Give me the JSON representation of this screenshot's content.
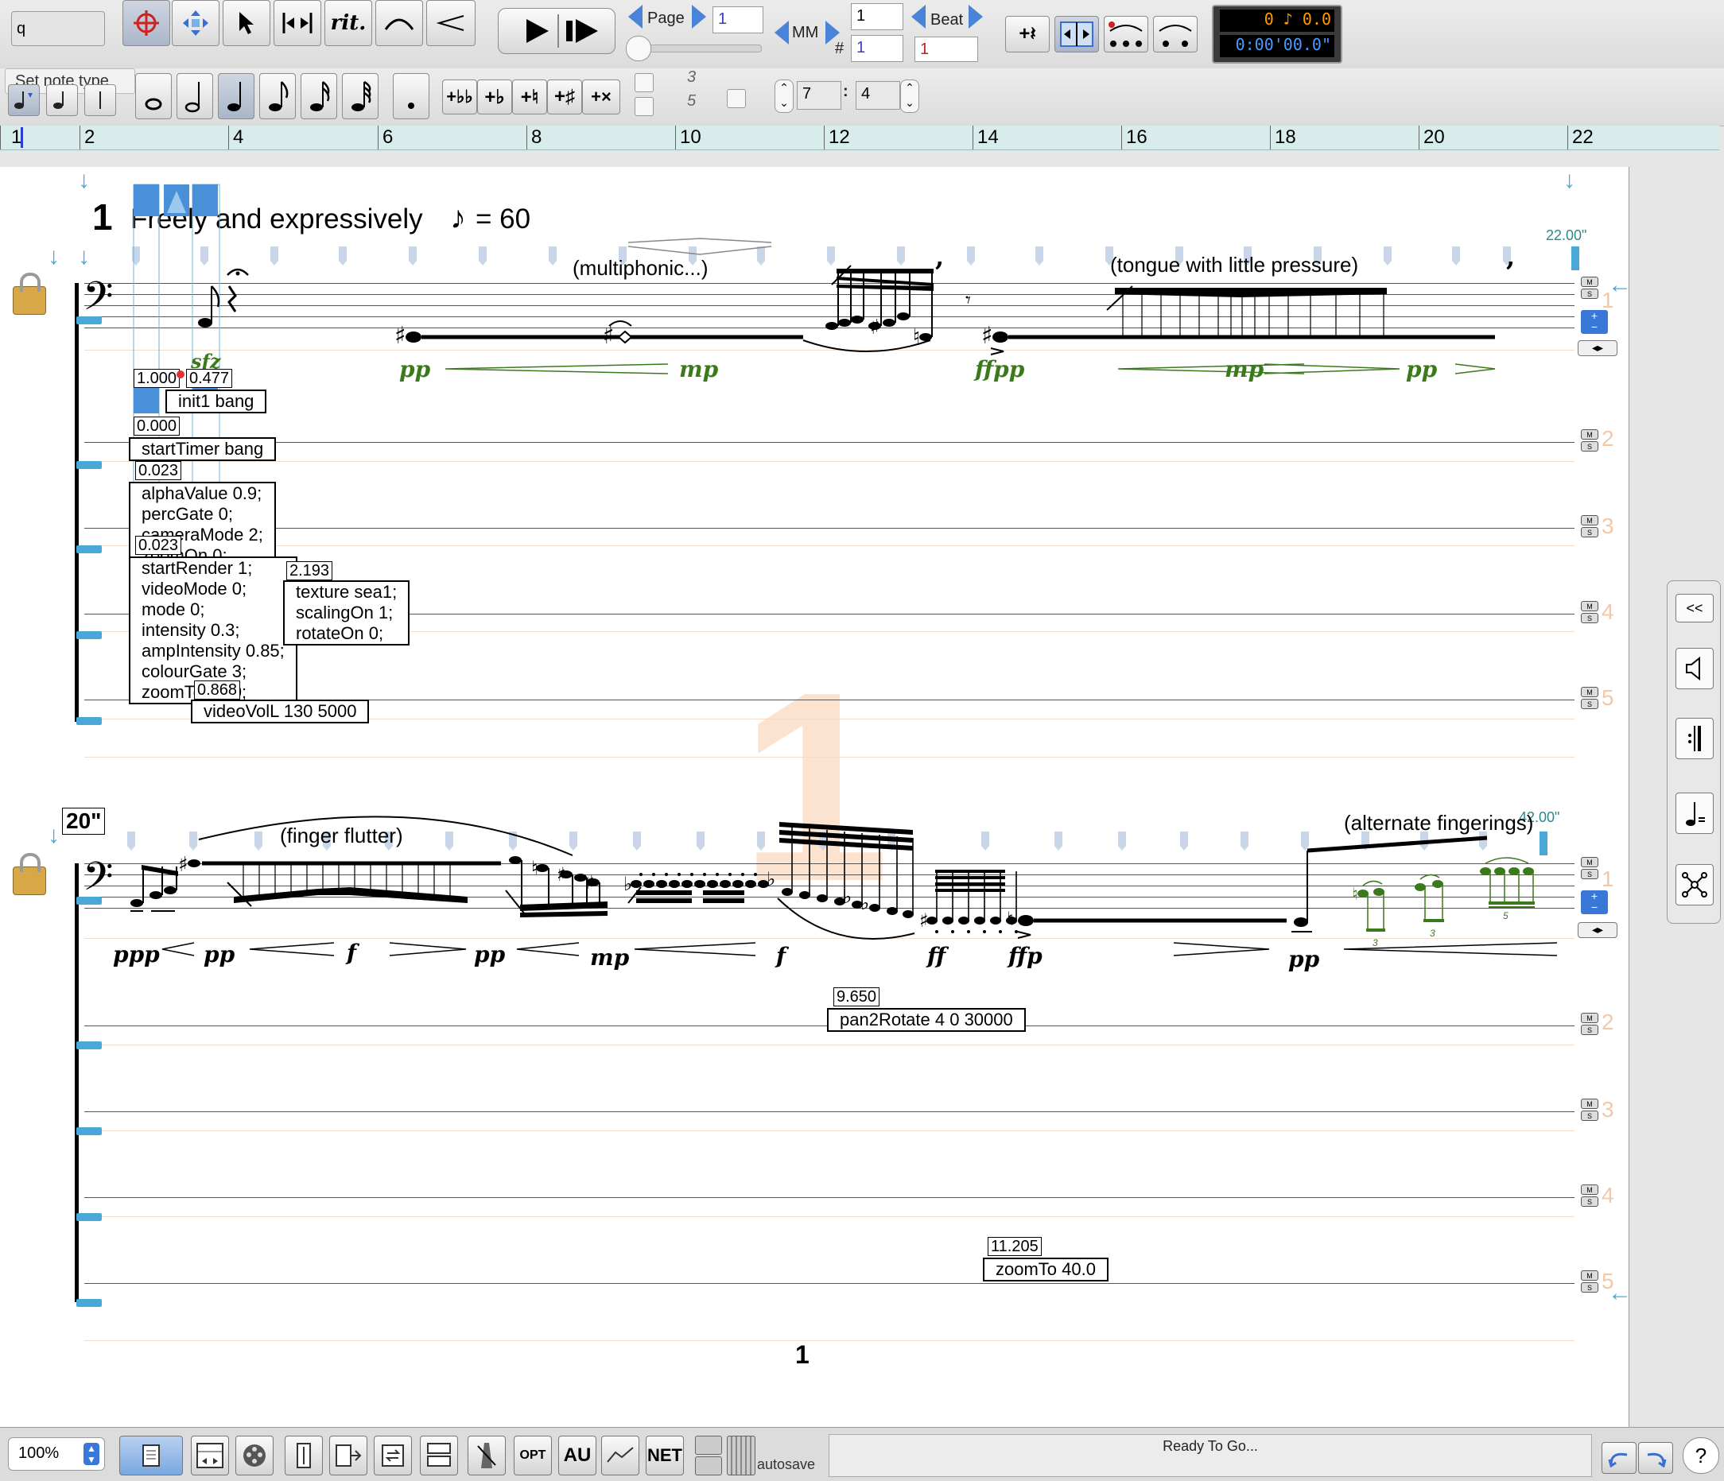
{
  "toolbar": {
    "search_value": "q",
    "tooltip": "Set note type",
    "tempo_marker_label": "rit.",
    "transport": {
      "page_label": "Page",
      "page_value": "1",
      "mm_label": "MM",
      "mm_value": "1",
      "mm_hash": "#",
      "mm_hash_value": "1",
      "beat_label": "Beat",
      "beat_value": "1"
    },
    "display_counter": "0 ♪ 0.0",
    "display_time": "0:00'00.0\"",
    "tuplet_top": "3",
    "tuplet_bottom": "5",
    "ratio_numerator": "7",
    "ratio_denominator": "4"
  },
  "ruler": {
    "marks": [
      "1",
      "2",
      "4",
      "6",
      "8",
      "10",
      "12",
      "14",
      "16",
      "18",
      "20",
      "22"
    ]
  },
  "score": {
    "rehearsal_number": "1",
    "tempo_text": "Freely and expressively",
    "tempo_value": "= 60",
    "time_marker_1": "22.00\"",
    "time_marker_2": "20\"",
    "time_marker_3": "42.00\"",
    "page_number": "1",
    "watermark": "1",
    "system1": {
      "performance_texts": [
        "(multiphonic...)",
        "(tongue with little pressure)"
      ],
      "dynamics": [
        "pp",
        "mp",
        "ffpp",
        "mp",
        "pp",
        "sfz"
      ]
    },
    "system2": {
      "performance_texts": [
        "(finger flutter)",
        "(alternate fingerings)"
      ],
      "dynamics": [
        "ppp",
        "pp",
        "f",
        "pp",
        "mp",
        "f",
        "ff",
        "ffp",
        "pp"
      ]
    },
    "track_labels": [
      "1",
      "2",
      "3",
      "4",
      "5"
    ],
    "messages": [
      {
        "time": "1.000",
        "time2": "0.477",
        "text": "init1 bang"
      },
      {
        "time": "0.000",
        "text": "startTimer bang"
      },
      {
        "time": "0.023",
        "text": "alphaValue 0.9;\npercGate 0;\ncameraMode 2;\nzoomOn 0;"
      },
      {
        "time": "0.023",
        "text": "startRender 1;\nvideoMode 0;\nmode 0;\nintensity 0.3;\nampIntensity 0.85;\ncolourGate 3;\nzoomTo 80.0;"
      },
      {
        "time": "2.193",
        "text": "texture sea1;\nscalingOn 1;\nrotateOn 0;"
      },
      {
        "time": "0.868",
        "text": "videoVolL 130 5000"
      },
      {
        "time": "9.650",
        "text": "pan2Rotate 4 0 30000"
      },
      {
        "time": "11.205",
        "text": "zoomTo 40.0"
      }
    ]
  },
  "side_panel": {
    "collapse_label": "<<"
  },
  "statusbar": {
    "zoom": "100%",
    "opt_label": "OPT",
    "au_label": "AU",
    "net_label": "NET",
    "autosave_label": "autosave",
    "status_text": "Ready To Go...",
    "help_label": "?"
  },
  "colors": {
    "accent_blue": "#4a84d8",
    "dynamics_green": "#3a7a1a",
    "ruler_bg": "#d9ecec",
    "watermark": "#fbe3cf"
  }
}
